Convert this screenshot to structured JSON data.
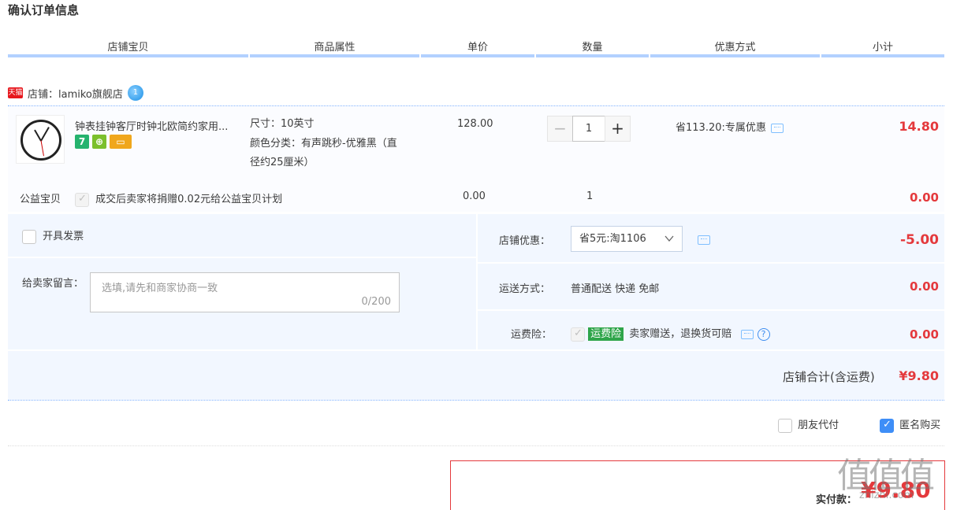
{
  "page_title": "确认订单信息",
  "columns": [
    "店铺宝贝",
    "商品属性",
    "单价",
    "数量",
    "优惠方式",
    "小计"
  ],
  "shop": {
    "badge": "天猫",
    "label": "店铺：lamiko旗舰店",
    "ww_badge": "1"
  },
  "item": {
    "title": "钟表挂钟客厅时钟北欧简约家用...",
    "service_icons": [
      "7",
      "⊕",
      "▭"
    ],
    "attr_size": "尺寸：10英寸",
    "attr_color_1": "颜色分类：有声跳秒-优雅黑（直",
    "attr_color_2": "径约25厘米）",
    "price": "128.00",
    "minus": "−",
    "quantity": "1",
    "plus": "+",
    "promo": "省113.20:专属优惠",
    "subtotal": "14.80"
  },
  "charity": {
    "label": "公益宝贝",
    "text": "成交后卖家将捐赠0.02元给公益宝贝计划",
    "price": "0.00",
    "qty": "1",
    "subtotal": "0.00"
  },
  "invoice_label": "开具发票",
  "memo": {
    "label": "给卖家留言：",
    "placeholder": "选填,请先和商家协商一致",
    "counter": "0/200"
  },
  "shop_discount": {
    "label": "店铺优惠：",
    "selected": "省5元:淘1106",
    "amount": "-5.00"
  },
  "shipping": {
    "label": "运送方式：",
    "value": "普通配送 快递 免邮",
    "amount": "0.00"
  },
  "freight_insurance": {
    "label": "运费险：",
    "badge": "运费险",
    "text": "卖家赠送，退换货可赔",
    "amount": "0.00"
  },
  "shop_total": {
    "label": "店铺合计(含运费)",
    "amount": "¥9.80"
  },
  "friend_pay": "朋友代付",
  "anonymous": "匿名购买",
  "pay": {
    "label": "实付款：",
    "amount": "¥9.80"
  },
  "watermark": {
    "text": "值值值",
    "url": "zhizhi.com"
  }
}
